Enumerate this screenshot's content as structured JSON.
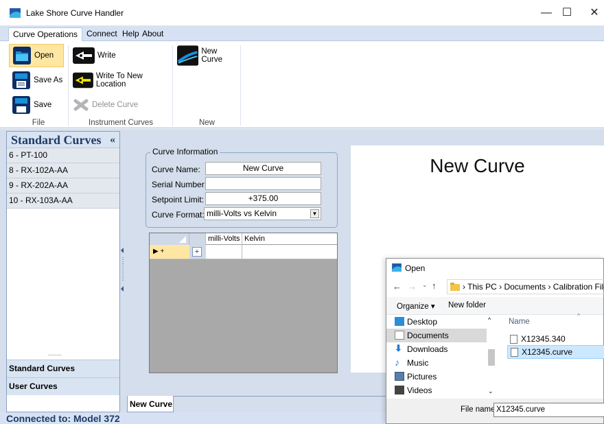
{
  "window": {
    "title": "Lake Shore Curve Handler",
    "minimize": "—",
    "maximize": "☐",
    "close": "✕"
  },
  "menu": {
    "tabs": [
      "Curve Operations",
      "Connect",
      "Help",
      "About"
    ]
  },
  "ribbon": {
    "file": {
      "open": "Open",
      "save_as": "Save As",
      "save": "Save",
      "group": "File"
    },
    "instrument": {
      "write": "Write",
      "write_new": "Write To New Location",
      "delete": "Delete Curve",
      "group": "Instrument Curves"
    },
    "new": {
      "new_curve": "New Curve",
      "group": "New"
    }
  },
  "sidebar": {
    "header": "Standard Curves",
    "collapse": "«",
    "items": [
      "6 - PT-100",
      "8 - RX-102A-AA",
      "9 - RX-202A-AA",
      "10 - RX-103A-AA"
    ],
    "grip": "........",
    "bottom": [
      "Standard Curves",
      "User Curves"
    ]
  },
  "curve_info": {
    "group_title": "Curve Information",
    "name_label": "Curve Name:",
    "name_value": "New Curve",
    "serial_label": "Serial Number:",
    "serial_value": "",
    "setpoint_label": "Setpoint Limit:",
    "setpoint_value": "+375.00",
    "format_label": "Curve Format:",
    "format_value": "milli-Volts vs Kelvin"
  },
  "grid": {
    "columns": [
      "milli-Volts",
      "Kelvin"
    ],
    "row_marker": "▶  +",
    "add": "+"
  },
  "preview": {
    "title": "New Curve"
  },
  "doc_tab": "New Curve",
  "status": "Connected to: Model 372",
  "dialog": {
    "title": "Open",
    "path": "› This PC › Documents › Calibration Files",
    "organize": "Organize ▾",
    "new_folder": "New folder",
    "nav": [
      "Desktop",
      "Documents",
      "Downloads",
      "Music",
      "Pictures",
      "Videos"
    ],
    "selected_nav": "Documents",
    "name_header": "Name",
    "files": [
      "X12345.340",
      "X12345.curve"
    ],
    "selected_file": "X12345.curve",
    "filename_label": "File name:",
    "filename_value": "X12345.curve"
  },
  "colors": {
    "ribbon_bg": "#d6e2f3",
    "panel_bg": "#d4deec",
    "highlight": "#ffe7a3",
    "selection": "#cce8ff",
    "status_text": "#1e3a66"
  }
}
